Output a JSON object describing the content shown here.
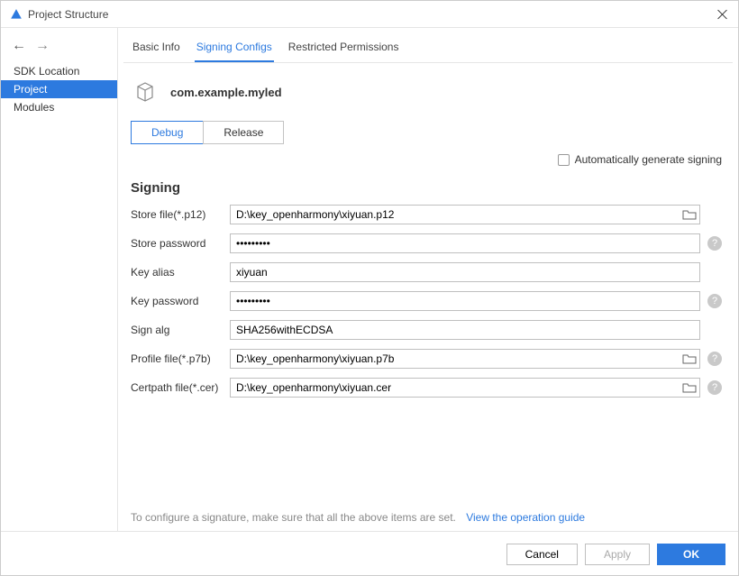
{
  "window": {
    "title": "Project Structure"
  },
  "sidebar": {
    "items": [
      "SDK Location",
      "Project",
      "Modules"
    ],
    "selected": 1
  },
  "tabs": {
    "items": [
      "Basic Info",
      "Signing Configs",
      "Restricted Permissions"
    ],
    "active": 1
  },
  "package": {
    "name": "com.example.myled"
  },
  "buildTabs": {
    "items": [
      "Debug",
      "Release"
    ],
    "active": 0
  },
  "auto": {
    "label": "Automatically generate signing",
    "checked": false
  },
  "section": "Signing",
  "form": {
    "storeFile": {
      "label": "Store file(*.p12)",
      "value": "D:\\key_openharmony\\xiyuan.p12"
    },
    "storePassword": {
      "label": "Store password",
      "value": "•••••••••"
    },
    "keyAlias": {
      "label": "Key alias",
      "value": "xiyuan"
    },
    "keyPassword": {
      "label": "Key password",
      "value": "•••••••••"
    },
    "signAlg": {
      "label": "Sign alg",
      "value": "SHA256withECDSA"
    },
    "profileFile": {
      "label": "Profile file(*.p7b)",
      "value": "D:\\key_openharmony\\xiyuan.p7b"
    },
    "certpathFile": {
      "label": "Certpath file(*.cer)",
      "value": "D:\\key_openharmony\\xiyuan.cer"
    }
  },
  "hint": {
    "text": "To configure a signature, make sure that all the above items are set.",
    "link": "View the operation guide"
  },
  "footer": {
    "cancel": "Cancel",
    "apply": "Apply",
    "ok": "OK"
  }
}
